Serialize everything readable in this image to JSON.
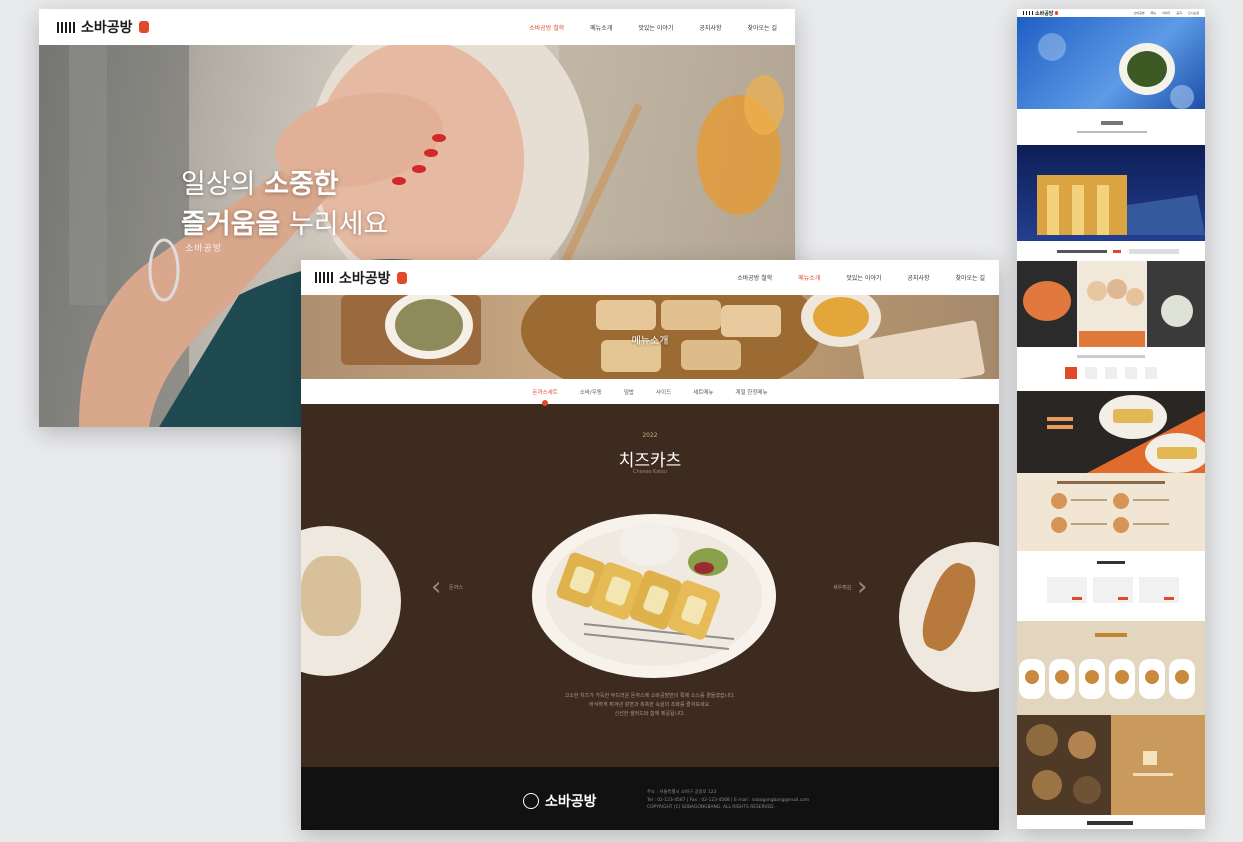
{
  "site_logo": "소바공방",
  "mockup_home": {
    "nav": [
      "소바공방 철학",
      "메뉴소개",
      "맛있는 이야기",
      "공지사항",
      "찾아오는 길"
    ],
    "hero": {
      "line1_pre": "일상의",
      "line1_bold": "소중한",
      "line2_bold": "즐거움을",
      "line2_post": "누리세요",
      "subtitle": "소바공방"
    }
  },
  "mockup_menu": {
    "nav": [
      "소바공방 철학",
      "메뉴소개",
      "맛있는 이야기",
      "공지사항",
      "찾아오는 길"
    ],
    "banner_title": "메뉴소개",
    "subnav": [
      "돈까스세트",
      "소바/우동",
      "덮밥",
      "사이드",
      "세트메뉴",
      "계절 한정메뉴"
    ],
    "feature": {
      "category_en": "2022",
      "dish_name": "치즈카츠",
      "dish_en": "Cheese Katsu",
      "prev_label": "돈까스",
      "next_label": "새우튀김",
      "description": [
        "고소한 치즈가 가득한 부드러운 돈까스에 소바공방만의 특제 소스를 곁들였습니다.",
        "바삭하게 튀겨낸 겉면과 촉촉한 속살의 조화를 즐겨보세요.",
        "신선한 샐러드와 함께 제공됩니다."
      ]
    },
    "footer": {
      "logo": "소바공방",
      "info": [
        "주소 : 서울특별시 소바구 공방로 123",
        "Tel : 02-123-4567 | Fax : 02-123-4568 | E-mail : sobagongbang@mail.com",
        "COPYRIGHT (C) SOBAGONGBANG. ALL RIGHTS RESERVED."
      ]
    }
  },
  "mockup_long": {
    "nav": [
      "소바공방",
      "메뉴",
      "이야기",
      "공지",
      "오시는길"
    ]
  }
}
